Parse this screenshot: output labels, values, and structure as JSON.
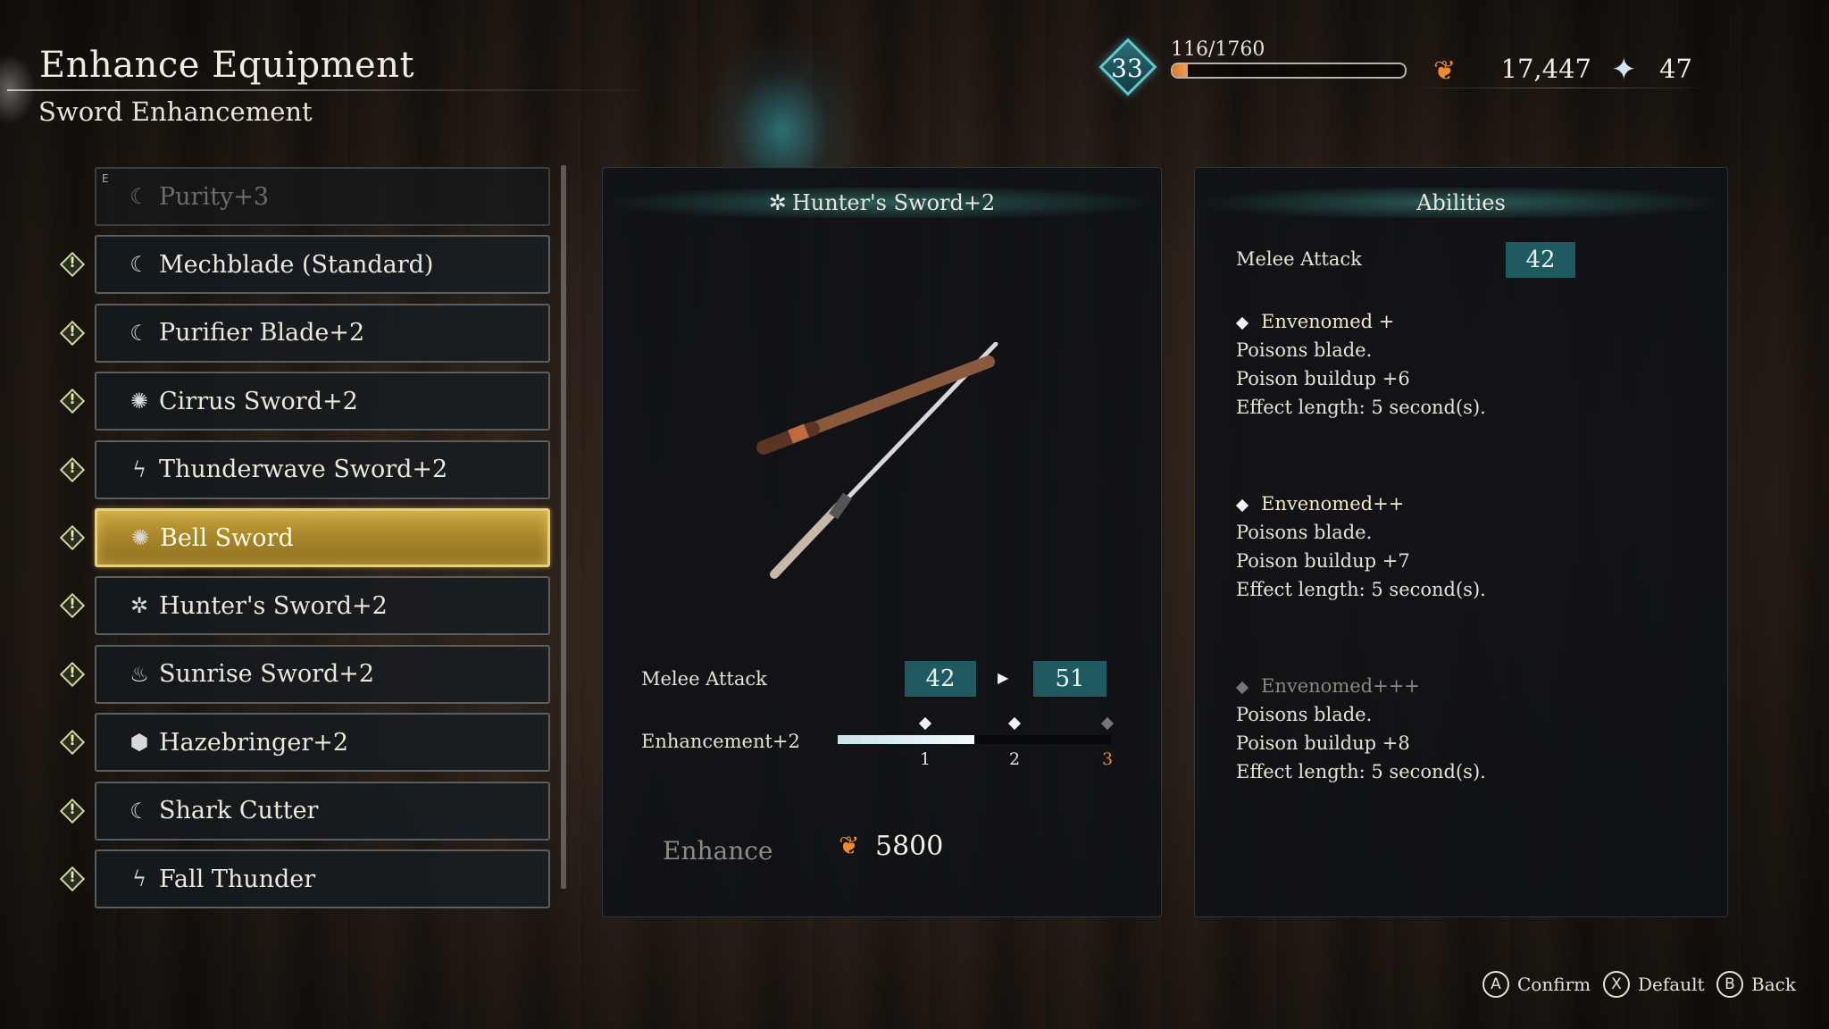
{
  "header": {
    "title": "Enhance Equipment",
    "subtitle": "Sword Enhancement"
  },
  "hud": {
    "level": "33",
    "xp_text": "116/1760",
    "xp_fraction": 0.066,
    "ergo": "17,447",
    "fragments": "47",
    "ergo_icon": "ergo-icon",
    "fragment_icon": "star-fragment-icon"
  },
  "list": {
    "items": [
      {
        "label": "Purity+3",
        "icon": "☾",
        "dim": true,
        "badge": "E"
      },
      {
        "label": "Mechblade (Standard)",
        "icon": "☾"
      },
      {
        "label": "Purifier Blade+2",
        "icon": "☾"
      },
      {
        "label": "Cirrus Sword+2",
        "icon": "✺"
      },
      {
        "label": "Thunderwave Sword+2",
        "icon": "ϟ"
      },
      {
        "label": "Bell Sword",
        "icon": "✺",
        "selected": true
      },
      {
        "label": "Hunter's Sword+2",
        "icon": "✲"
      },
      {
        "label": "Sunrise Sword+2",
        "icon": "♨"
      },
      {
        "label": "Hazebringer+2",
        "icon": "⬢"
      },
      {
        "label": "Shark Cutter",
        "icon": "☾"
      },
      {
        "label": "Fall Thunder",
        "icon": "ϟ"
      }
    ]
  },
  "detail": {
    "title": "Hunter's Sword+2",
    "title_icon": "✲",
    "stat_label": "Melee Attack",
    "stat_current": "42",
    "stat_next": "51",
    "enh_label": "Enhancement+2",
    "enh_fraction": 0.5,
    "ticks": [
      "1",
      "2",
      "3"
    ],
    "enhance_label": "Enhance",
    "cost": "5800"
  },
  "abilities": {
    "title": "Abilities",
    "stat_label": "Melee Attack",
    "stat_value": "42",
    "groups": [
      {
        "name": "Envenomed +",
        "lines": [
          "Poisons blade.",
          "Poison buildup +6",
          "Effect length: 5 second(s)."
        ],
        "dim": false
      },
      {
        "name": "Envenomed++",
        "lines": [
          "Poisons blade.",
          "Poison buildup +7",
          "Effect length: 5 second(s)."
        ],
        "dim": false
      },
      {
        "name": "Envenomed+++",
        "lines": [
          "Poisons blade.",
          "Poison buildup +8",
          "Effect length: 5 second(s)."
        ],
        "dim": true
      }
    ]
  },
  "prompts": [
    {
      "key": "A",
      "label": "Confirm"
    },
    {
      "key": "X",
      "label": "Default"
    },
    {
      "key": "B",
      "label": "Back"
    }
  ]
}
